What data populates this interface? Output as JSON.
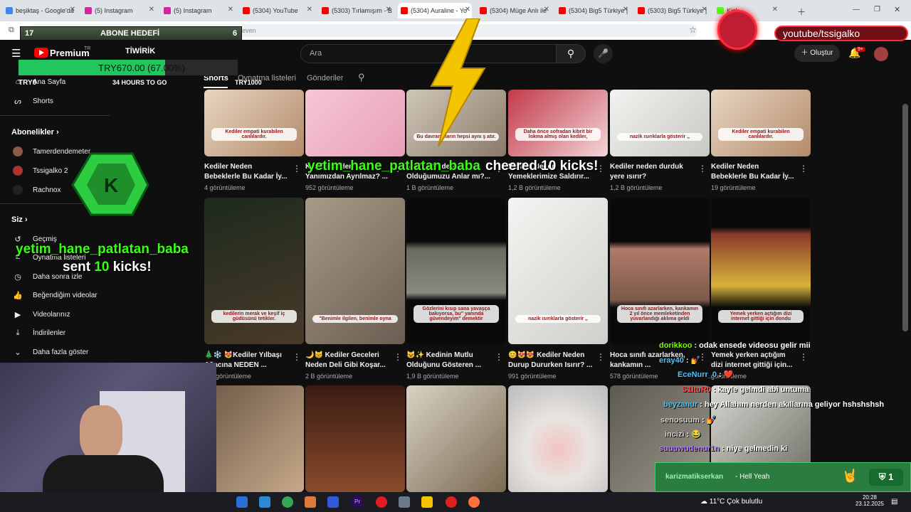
{
  "browser": {
    "tabs": [
      {
        "label": "beşiktaş - Google'da",
        "color": "#4285f4"
      },
      {
        "label": "(5) Instagram",
        "color": "#d6249f"
      },
      {
        "label": "(5) Instagram",
        "color": "#d6249f"
      },
      {
        "label": "(5304) YouTube",
        "color": "#ff0000"
      },
      {
        "label": "(5303) Tırlamışım - B",
        "color": "#ff0000"
      },
      {
        "label": "(5304) Auraline - Yo",
        "color": "#ff0000",
        "active": true
      },
      {
        "label": "(5304) Müge Anlı ile",
        "color": "#ff0000"
      },
      {
        "label": "(5304) Big5 Türkiye |",
        "color": "#ff0000"
      },
      {
        "label": "(5303) Big5 Türkiye |",
        "color": "#ff0000"
      },
      {
        "label": "Kick",
        "color": "#53fc18"
      }
    ],
    "address_fragment": "even"
  },
  "youtube": {
    "premium": "Premium",
    "premium_tr": "TR",
    "search_placeholder": "Ara",
    "create_label": "Oluştur",
    "notif_count": "9+",
    "channel_tabs": [
      "Shorts",
      "Oynatma listeleri",
      "Gönderiler"
    ]
  },
  "sidebar": {
    "home": "Ana Sayfa",
    "shorts": "Shorts",
    "subs_header": "Abonelikler",
    "subs": [
      "Tamerdendemeter",
      "Tssigalko 2",
      "Rachnox"
    ],
    "you_header": "Siz",
    "you_items": [
      "Geçmiş",
      "Oynatma listeleri",
      "Daha sonra izle",
      "Beğendiğim videolar",
      "Videolarınız",
      "İndirilenler",
      "Daha fazla göster"
    ]
  },
  "videos": [
    {
      "title": "Kediler Neden\nBebeklerle Bu Kadar İy...",
      "views": "4 görüntüleme",
      "caption": "Kediler empati kurabilen canlılardır."
    },
    {
      "title": "Kediler Neden\nYanımızdan Ayrılmaz? ...",
      "views": "952 görüntüleme",
      "caption": ""
    },
    {
      "title": "Kediler Neden\nOlduğumuzu Anlar mı?...",
      "views": "1 B görüntüleme",
      "caption": "Bu davranışların hepsi aynı ş atır."
    },
    {
      "title": "Kediler Neden\nYemeklerimize Saldırır...",
      "views": "1,2 B görüntüleme",
      "caption": "Daha önce sofradan kibrit bir lokma almış olan kediler,"
    },
    {
      "title": "Kediler neden durduk\nyere ısırır?",
      "views": "1,2 B görüntüleme",
      "caption": "nazik ısırıklarla gösterir ,,"
    },
    {
      "title": "Kediler Neden\nBebeklerle Bu Kadar İy...",
      "views": "19 görüntüleme",
      "caption": "Kediler empati kurabilen canlılardır."
    },
    {
      "title": "🎄❄️ 😻Kediler Yılbaşı\nAğacına NEDEN ...",
      "views": "3 B görüntüleme",
      "caption": "kedilerin merak ve keşif iç güdüsünü tetikler."
    },
    {
      "title": "🌙😸 Kediler Geceleri\nNeden Deli Gibi Koşar...",
      "views": "2 B görüntüleme",
      "caption": "\"Benimle ilgilen, benimle oyna"
    },
    {
      "title": "😺✨ Kedinin Mutlu\nOlduğunu Gösteren ...",
      "views": "1,9 B görüntüleme",
      "caption": "Gözlerini kısıp sana yavaşça bakıyorsa, bu\" yanında güvendeyim\" demektir"
    },
    {
      "title": "😊😻😻 Kediler Neden\nDurup Dururken Isırır? ...",
      "views": "991 görüntüleme",
      "caption": "nazik ısırıklarla gösterir ,,"
    },
    {
      "title": "Hoca sınıfı azarlarken,\nkankamın ...",
      "views": "578 görüntüleme",
      "caption": "Hoca sınıfı azarlarken, kankamın 2 yıl önce memleketinden yuvarlandığı aklıma geldi"
    },
    {
      "title": "Yemek yerken açtığım\ndizi internet gittiği için...",
      "views": "görüntüleme",
      "caption": "Yemek yerken açtığım dizi internet gittiği için dondu"
    }
  ],
  "overlay": {
    "goal_count": "17",
    "goal_label": "ABONE HEDEFİ",
    "goal_target": "6",
    "tiwirik": "TİWİRİK",
    "try_amount": "TRY670.00 (67.00%)",
    "try_progress": 0.67,
    "try_left": "TRY0",
    "try_right": "TRY1000",
    "hours": "34 HOURS TO GO",
    "cheer_name": "yetim_hane_patlatan_baba",
    "cheer_text": "cheered 10 kicks!",
    "sent_name": "yetim_hane_patlatan_baba",
    "sent_prefix": "sent",
    "sent_num": "10",
    "sent_suffix": "kicks!",
    "yt_channel": "youtube/tssigalko",
    "kick_user": "karizmatikserkan",
    "kick_msg": "- Hell Yeah",
    "kick_count": "1"
  },
  "chat": [
    {
      "user": "dorikkoo",
      "color": "#7CFC00",
      "msg": ": odak ensede videosu gelir mii"
    },
    {
      "user": "eray40",
      "color": "#4fc3f7",
      "msg": ": 💅"
    },
    {
      "user": "EceNurr_0",
      "color": "#4fc3f7",
      "msg": ": ❤️"
    },
    {
      "user": "S1ltuR0",
      "color": "#ff4d4d",
      "msg": ": kayle gelmdi abi untuma"
    },
    {
      "user": "beyzanur",
      "color": "#4fc3f7",
      "msg": ": hey Allahım nerden akıllarına geliyor hshshshsh"
    },
    {
      "user": "senosuum",
      "color": "#cfcfcf",
      "msg": ": 💅"
    },
    {
      "user": "incizi",
      "color": "#cfcfcf",
      "msg": ": 😂"
    },
    {
      "user": "suuuwudenur1n",
      "color": "#b57cff",
      "msg": ": niye gelmedin ki"
    }
  ],
  "taskbar": {
    "weather": "11°C  Çok bulutlu",
    "time": "20:28",
    "date": "23.12.2025"
  }
}
